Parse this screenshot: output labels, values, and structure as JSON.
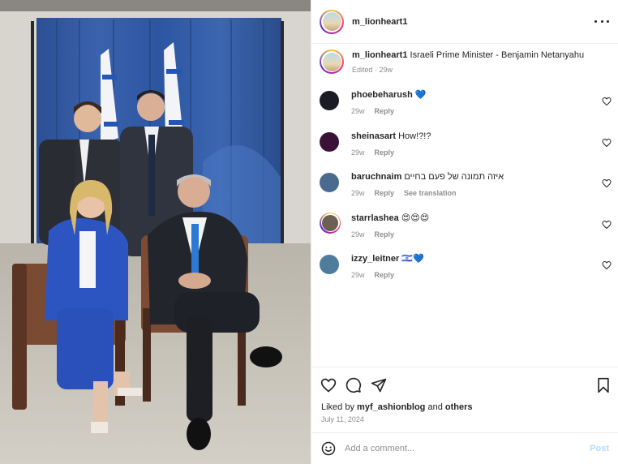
{
  "post": {
    "author": "m_lionheart1",
    "caption_user": "m_lionheart1",
    "caption": "Israeli Prime Minister - Benjamin Netanyahu",
    "caption_meta": "Edited · 29w",
    "more_icon": "more-horizontal-icon"
  },
  "comments": [
    {
      "user": "phoebeharush",
      "text": "💙",
      "time": "29w",
      "reply": "Reply",
      "translate": "",
      "avatar_color": "#1c1c24"
    },
    {
      "user": "sheinasart",
      "text": "How!?!?",
      "time": "29w",
      "reply": "Reply",
      "translate": "",
      "avatar_color": "#3a1238"
    },
    {
      "user": "baruchnaim",
      "text": "איזה תמונה של פעם בחיים",
      "time": "29w",
      "reply": "Reply",
      "translate": "See translation",
      "avatar_color": "#4b6a8f"
    },
    {
      "user": "starrlashea",
      "text": "😍😍😍",
      "time": "29w",
      "reply": "Reply",
      "translate": "",
      "avatar_color": "#6b6052"
    },
    {
      "user": "izzy_leitner",
      "text": "🇮🇱💙",
      "time": "29w",
      "reply": "Reply",
      "translate": "",
      "avatar_color": "#4d7c9c"
    }
  ],
  "actions": {
    "like_icon": "heart-icon",
    "comment_icon": "comment-bubble-icon",
    "share_icon": "send-icon",
    "save_icon": "bookmark-icon"
  },
  "likes": {
    "prefix": "Liked by",
    "user": "myf_ashionblog",
    "and": "and",
    "others": "others"
  },
  "date": "July 11, 2024",
  "composer": {
    "placeholder": "Add a comment...",
    "post_label": "Post",
    "emoji_icon": "emoji-smiley-icon"
  },
  "colors": {
    "link_blue_disabled": "#b3dbff",
    "verified_blue": "#3897f0",
    "muted_gray": "#8e8e8e"
  }
}
